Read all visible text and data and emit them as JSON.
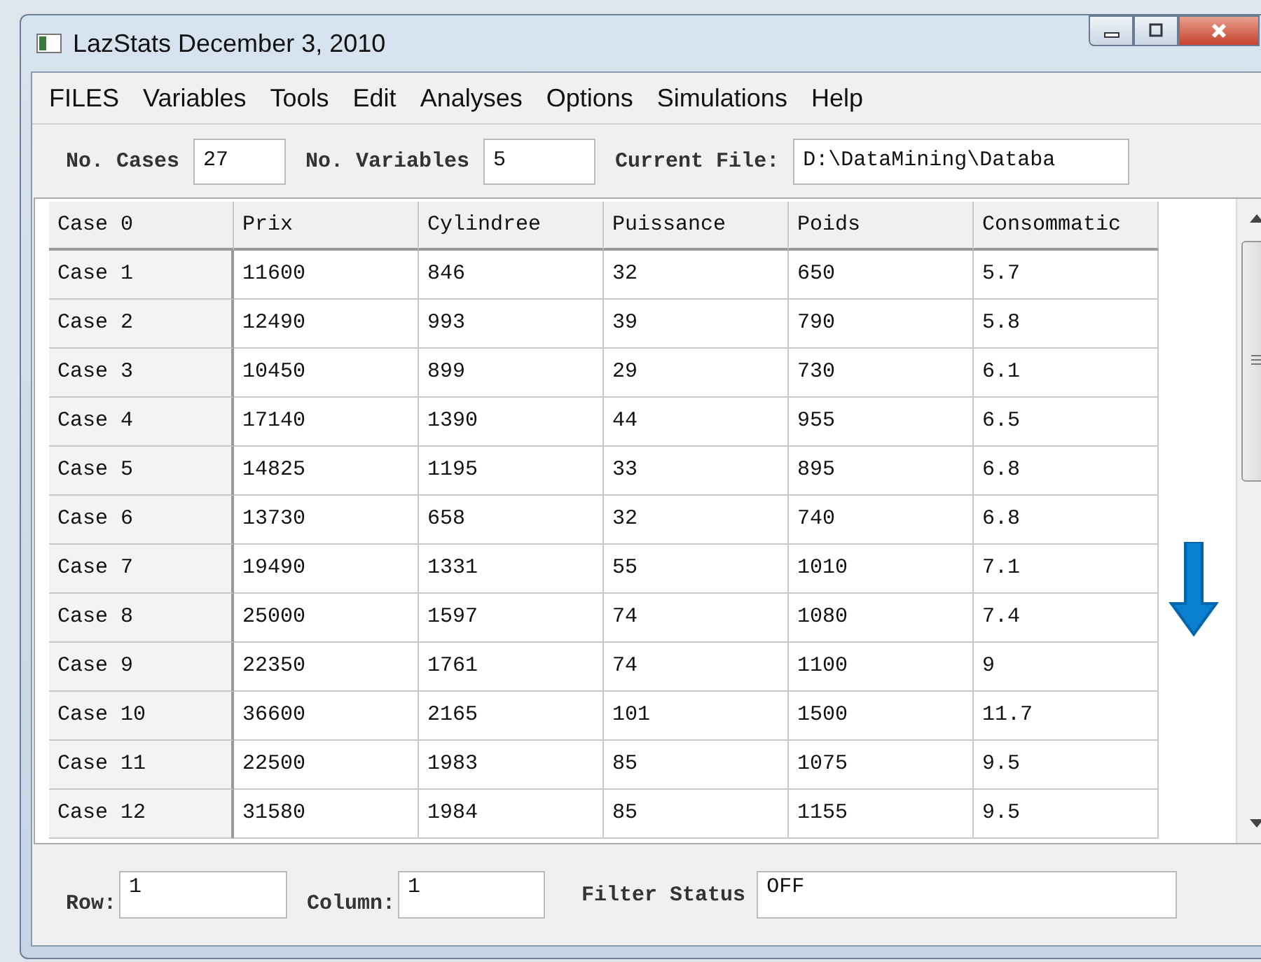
{
  "window": {
    "title": "LazStats December 3, 2010"
  },
  "menu": [
    "FILES",
    "Variables",
    "Tools",
    "Edit",
    "Analyses",
    "Options",
    "Simulations",
    "Help"
  ],
  "toolbar": [
    {
      "label": "No. Cases",
      "value": "27"
    },
    {
      "label": "No. Variables",
      "value": "5"
    },
    {
      "label": "Current File:",
      "value": "D:\\DataMining\\Databa"
    }
  ],
  "grid": {
    "columns": [
      "Case 0",
      "Prix",
      "Cylindree",
      "Puissance",
      "Poids",
      "Consommatic"
    ],
    "rows": [
      [
        "Case 1",
        "11600",
        "846",
        "32",
        "650",
        "5.7"
      ],
      [
        "Case 2",
        "12490",
        "993",
        "39",
        "790",
        "5.8"
      ],
      [
        "Case 3",
        "10450",
        "899",
        "29",
        "730",
        "6.1"
      ],
      [
        "Case 4",
        "17140",
        "1390",
        "44",
        "955",
        "6.5"
      ],
      [
        "Case 5",
        "14825",
        "1195",
        "33",
        "895",
        "6.8"
      ],
      [
        "Case 6",
        "13730",
        "658",
        "32",
        "740",
        "6.8"
      ],
      [
        "Case 7",
        "19490",
        "1331",
        "55",
        "1010",
        "7.1"
      ],
      [
        "Case 8",
        "25000",
        "1597",
        "74",
        "1080",
        "7.4"
      ],
      [
        "Case 9",
        "22350",
        "1761",
        "74",
        "1100",
        "9"
      ],
      [
        "Case 10",
        "36600",
        "2165",
        "101",
        "1500",
        "11.7"
      ],
      [
        "Case 11",
        "22500",
        "1983",
        "85",
        "1075",
        "9.5"
      ],
      [
        "Case 12",
        "31580",
        "1984",
        "85",
        "1155",
        "9.5"
      ]
    ]
  },
  "status": [
    {
      "label": "Row:",
      "value": "1"
    },
    {
      "label": "Column:",
      "value": "1"
    },
    {
      "label": "Filter Status",
      "value": "OFF"
    }
  ]
}
